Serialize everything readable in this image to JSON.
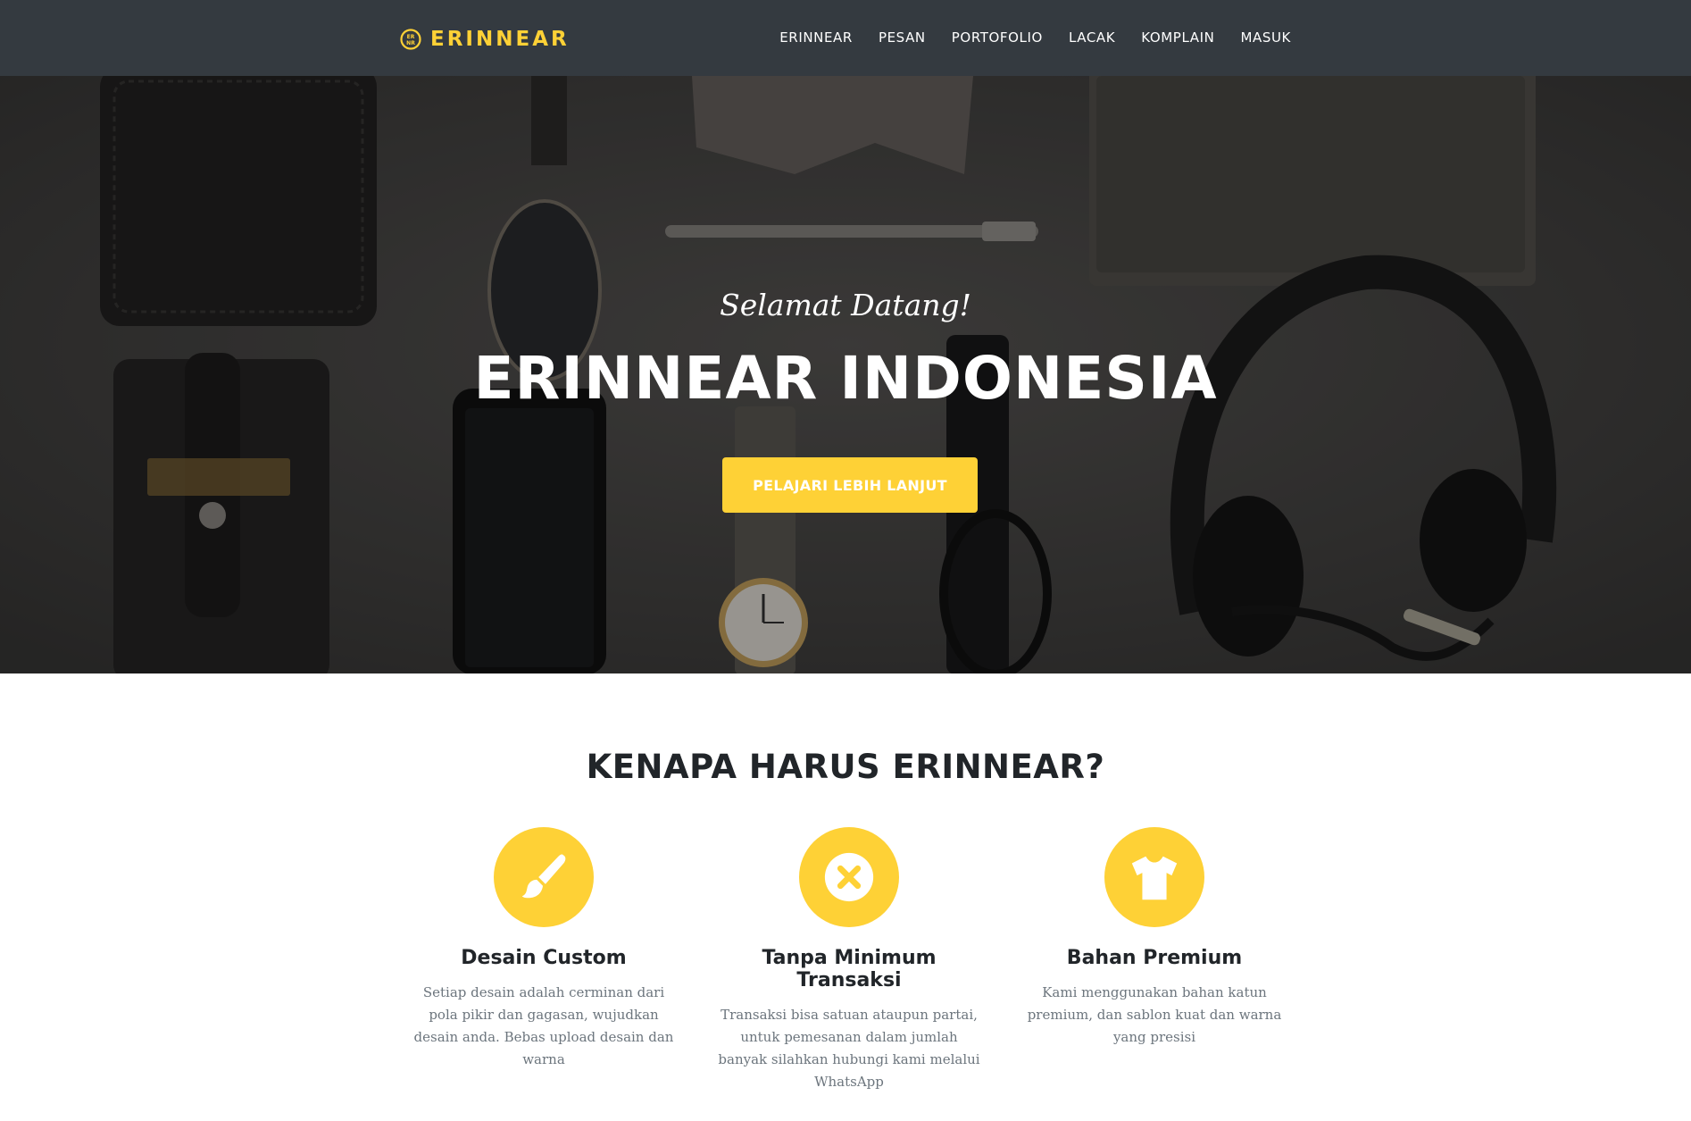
{
  "colors": {
    "accent": "#fed136",
    "navbar": "#343a40",
    "heading": "#212529",
    "muted": "#6c757d"
  },
  "brand": {
    "name": "ERINNEAR",
    "icon": "erinnear-logo-icon"
  },
  "nav": {
    "items": [
      {
        "label": "ERINNEAR"
      },
      {
        "label": "PESAN"
      },
      {
        "label": "PORTOFOLIO"
      },
      {
        "label": "LACAK"
      },
      {
        "label": "KOMPLAIN"
      },
      {
        "label": "MASUK"
      }
    ]
  },
  "hero": {
    "welcome": "Selamat Datang!",
    "title": "ERINNEAR INDONESIA",
    "cta_label": "PELAJARI LEBIH LANJUT"
  },
  "features": {
    "title": "KENAPA HARUS ERINNEAR?",
    "items": [
      {
        "icon": "paint-brush-icon",
        "title": "Desain Custom",
        "desc": "Setiap desain adalah cerminan dari pola pikir dan gagasan, wujudkan desain anda. Bebas upload desain dan warna"
      },
      {
        "icon": "times-circle-icon",
        "title": "Tanpa Minimum Transaksi",
        "desc": "Transaksi bisa satuan ataupun partai, untuk pemesanan dalam jumlah banyak silahkan hubungi kami melalui WhatsApp"
      },
      {
        "icon": "t-shirt-icon",
        "title": "Bahan Premium",
        "desc": "Kami menggunakan bahan katun premium, dan sablon kuat dan warna yang presisi"
      }
    ]
  }
}
